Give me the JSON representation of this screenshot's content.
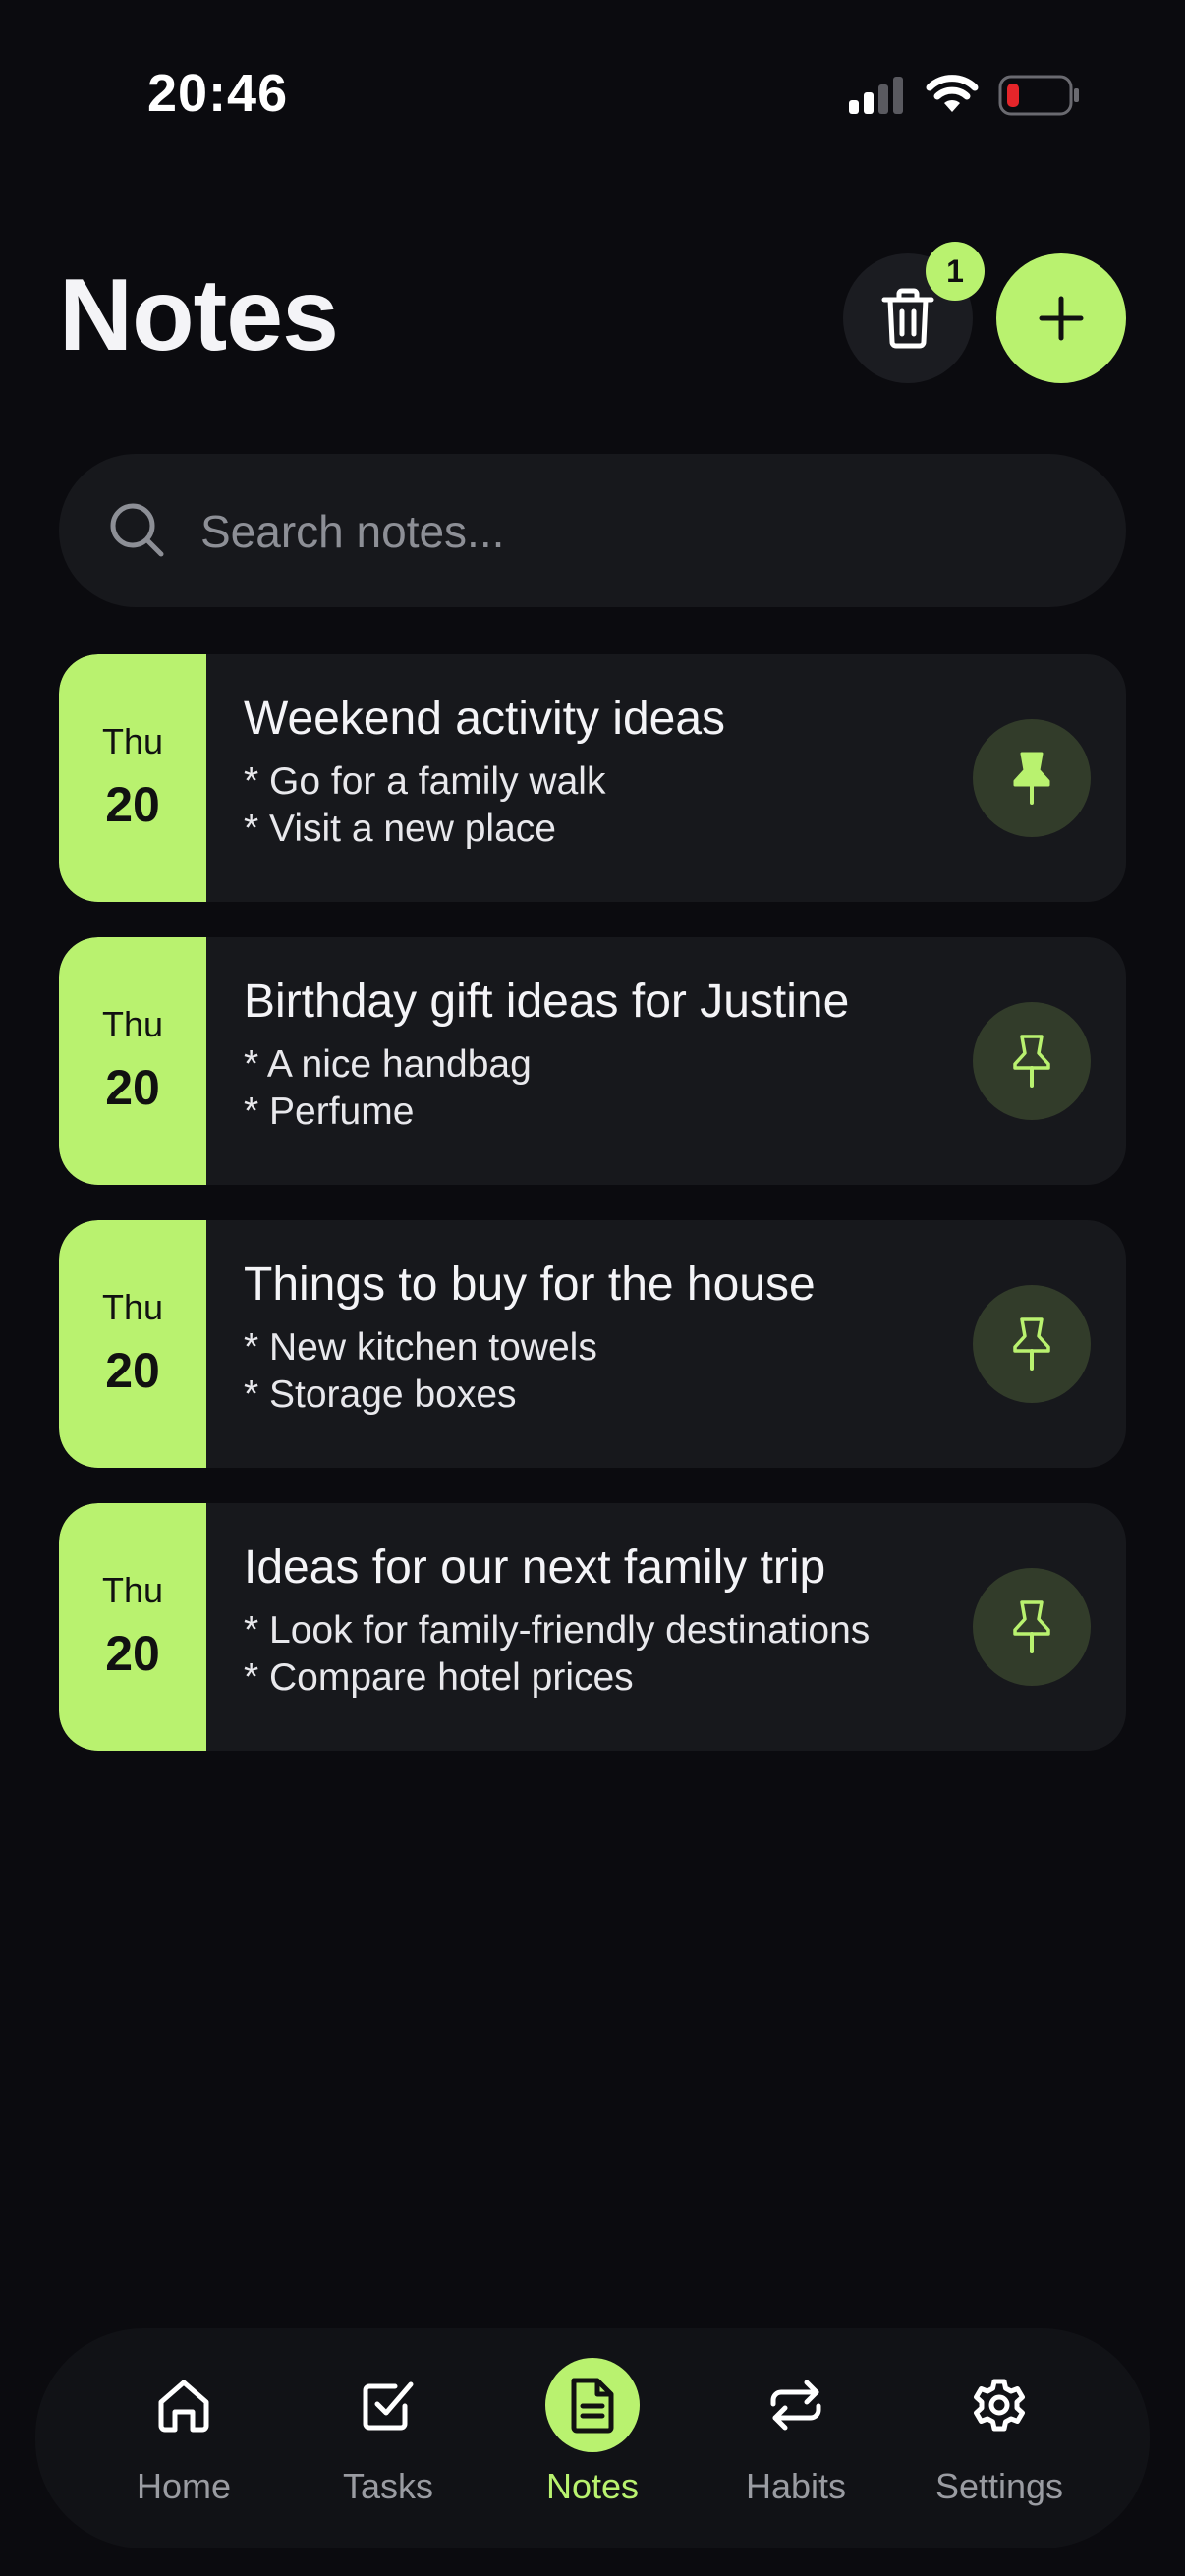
{
  "status_bar": {
    "time": "20:46",
    "icons": [
      "signal-icon",
      "wifi-icon",
      "battery-icon"
    ]
  },
  "header": {
    "title": "Notes",
    "trash_badge_count": "1",
    "icons": [
      "trash-icon",
      "plus-icon"
    ]
  },
  "search": {
    "placeholder": "Search notes...",
    "value": ""
  },
  "notes": [
    {
      "day": "Thu",
      "date": "20",
      "title": "Weekend activity ideas",
      "line1": "* Go for a family walk",
      "line2": "* Visit a new place",
      "pinned": true
    },
    {
      "day": "Thu",
      "date": "20",
      "title": "Birthday gift ideas for Justine",
      "line1": "* A nice handbag",
      "line2": "* Perfume",
      "pinned": false
    },
    {
      "day": "Thu",
      "date": "20",
      "title": "Things to buy for the house",
      "line1": "* New kitchen towels",
      "line2": "* Storage boxes",
      "pinned": false
    },
    {
      "day": "Thu",
      "date": "20",
      "title": "Ideas for our next family trip",
      "line1": "* Look for family-friendly destinations",
      "line2": "* Compare hotel prices",
      "pinned": false
    }
  ],
  "nav": {
    "items": [
      {
        "label": "Home",
        "icon": "home-icon",
        "active": false
      },
      {
        "label": "Tasks",
        "icon": "checkbox-icon",
        "active": false
      },
      {
        "label": "Notes",
        "icon": "document-icon",
        "active": true
      },
      {
        "label": "Habits",
        "icon": "repeat-icon",
        "active": false
      },
      {
        "label": "Settings",
        "icon": "gear-icon",
        "active": false
      }
    ]
  },
  "colors": {
    "accent": "#b9f26f",
    "background": "#0b0b0f",
    "card": "#17181c",
    "pin_bg": "#323c2a",
    "battery_low": "#e5252a"
  }
}
